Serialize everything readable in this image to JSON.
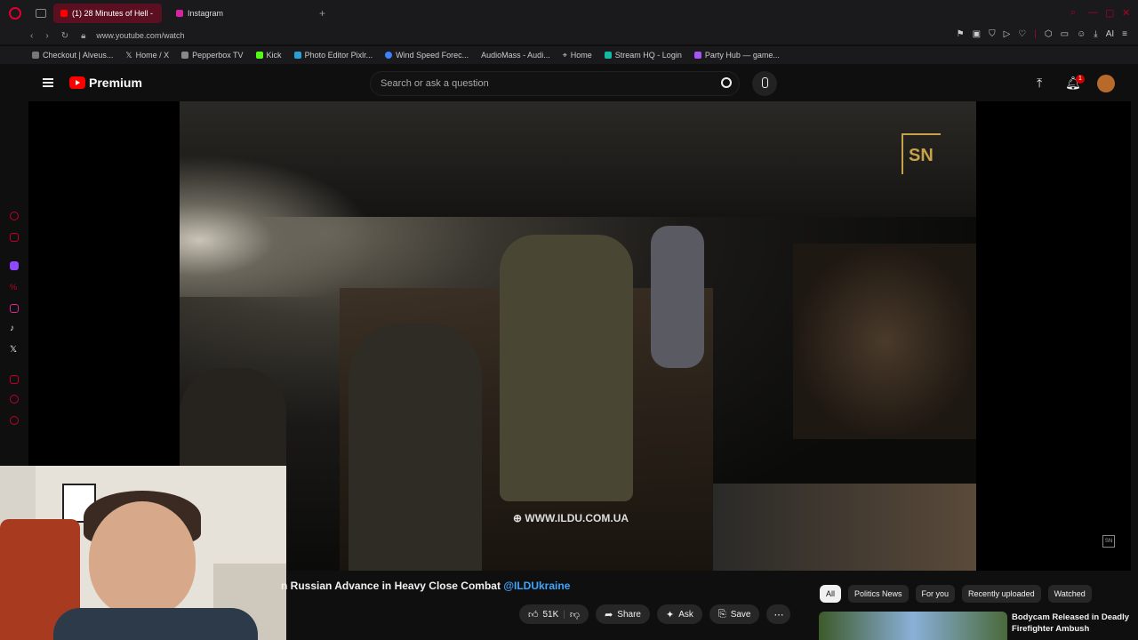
{
  "browser": {
    "tabs": [
      {
        "label": "(1) 28 Minutes of Hell -",
        "active": true
      },
      {
        "label": "Instagram",
        "active": false
      }
    ],
    "url": "www.youtube.com/watch",
    "bookmarks": [
      "Checkout | Alveus...",
      "Home / X",
      "Pepperbox TV",
      "Kick",
      "Photo Editor Pixlr...",
      "Wind Speed Forec...",
      "AudioMass - Audi...",
      "Home",
      "Stream HQ - Login",
      "Party Hub — game..."
    ],
    "ai_label": "AI"
  },
  "youtube": {
    "brand": "Premium",
    "search_placeholder": "Search or ask a question",
    "notification_count": "1",
    "accent": "#ff0000"
  },
  "video": {
    "channel_logo_text": "SN",
    "watermark": "WWW.ILDU.COM.UA",
    "title_visible": "n Russian Advance in Heavy Close Combat",
    "title_handle": "@ILDUkraine",
    "likes": "51K",
    "share_label": "Share",
    "ask_label": "Ask",
    "save_label": "Save"
  },
  "chips": [
    "All",
    "Politics News",
    "For you",
    "Recently uploaded",
    "Watched"
  ],
  "recommendation": {
    "title": "Bodycam Released in Deadly Firefighter Ambush"
  }
}
